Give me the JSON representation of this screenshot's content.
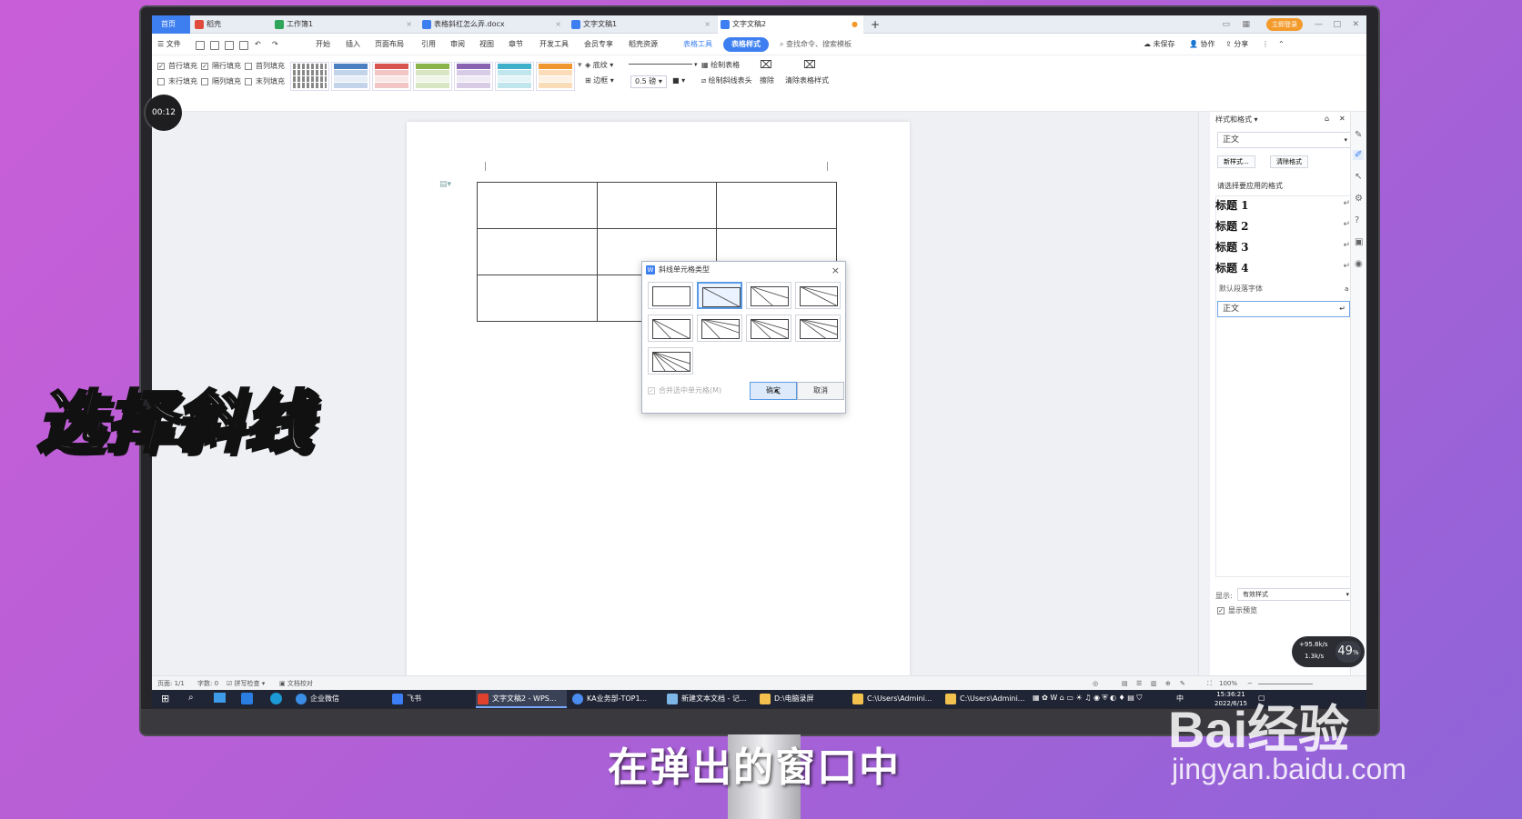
{
  "window": {
    "tabs": [
      {
        "label": "首页",
        "type": "home"
      },
      {
        "label": "稻壳",
        "type": "docer"
      },
      {
        "label": "工作簿1",
        "type": "sheet"
      },
      {
        "label": "表格斜杠怎么弄.docx",
        "type": "doc"
      },
      {
        "label": "文字文稿1",
        "type": "doc"
      },
      {
        "label": "文字文稿2",
        "type": "doc",
        "active": true
      }
    ],
    "new_tab": "+",
    "login_label": "立即登录"
  },
  "menu": {
    "file": "文件",
    "items": [
      "开始",
      "插入",
      "页面布局",
      "引用",
      "审阅",
      "视图",
      "章节",
      "开发工具",
      "会员专享",
      "稻壳资源"
    ],
    "table_tools": "表格工具",
    "table_style": "表格样式",
    "search_placeholder": "查找命令、搜索模板",
    "unsaved": "未保存",
    "collab": "协作",
    "share": "分享"
  },
  "ribbon": {
    "checks": [
      {
        "label": "首行填充",
        "checked": true
      },
      {
        "label": "隔行填充",
        "checked": true
      },
      {
        "label": "首列填充",
        "checked": false
      },
      {
        "label": "末行填充",
        "checked": false
      },
      {
        "label": "隔列填充",
        "checked": false
      },
      {
        "label": "末列填充",
        "checked": false
      }
    ],
    "shading": "底纹",
    "border": "边框",
    "line_width": "0.5",
    "unit": "磅",
    "draw_table": "绘制表格",
    "draw_diagonal": "绘制斜线表头",
    "erase": "擦除",
    "clear_style": "清除表格样式",
    "swatch_colors": [
      "#999999",
      "#4a7fc1",
      "#d9534f",
      "#8ab34a",
      "#8a64b0",
      "#3fb0c9",
      "#f0962e"
    ]
  },
  "dialog": {
    "title": "斜线单元格类型",
    "merge_label": "合并选中单元格(M)",
    "ok": "确定",
    "cancel": "取消",
    "selected_index": 1,
    "options": [
      "none",
      "single-tl-br",
      "two-from-tl-bottom",
      "two-from-tl-right",
      "two-from-tl-br-steep",
      "two-from-tl-br-shallow",
      "three-from-tl-a",
      "three-from-tl-b",
      "three-from-tl-c"
    ]
  },
  "styles_panel": {
    "title": "样式和格式",
    "current": "正文",
    "new_style": "新样式...",
    "clear_format": "清除格式",
    "prompt": "请选择要应用的格式",
    "headings": [
      "标题 1",
      "标题 2",
      "标题 3",
      "标题 4"
    ],
    "default_font": "默认段落字体",
    "normal": "正文",
    "show_label": "显示:",
    "show_value": "有效样式",
    "preview_label": "显示预览"
  },
  "statusbar": {
    "page": "页面: 1/1",
    "words": "字数: 0",
    "spellcheck": "拼写检查",
    "proofread": "文档校对",
    "zoom": "100%"
  },
  "taskbar": {
    "items": [
      {
        "label": "企业微信"
      },
      {
        "label": "飞书"
      },
      {
        "label": "文字文稿2 - WPS...",
        "active": true
      },
      {
        "label": "KA业务部-TOP1..."
      },
      {
        "label": "新建文本文档 - 记..."
      },
      {
        "label": "D:\\电脑录屏"
      },
      {
        "label": "C:\\Users\\Admini..."
      },
      {
        "label": "C:\\Users\\Admini..."
      }
    ],
    "ime": "中",
    "time": "15:36:21",
    "date": "2022/6/15"
  },
  "overlay": {
    "timer": "00:12",
    "net_up": "+95.8k/s",
    "net_down": "1.3k/s",
    "cpu": "49",
    "cpu_unit": "%",
    "caption_big": "选择斜线",
    "subtitle": "在弹出的窗口中",
    "watermark_brand": "Bai经验",
    "watermark_url": "jingyan.baidu.com"
  }
}
